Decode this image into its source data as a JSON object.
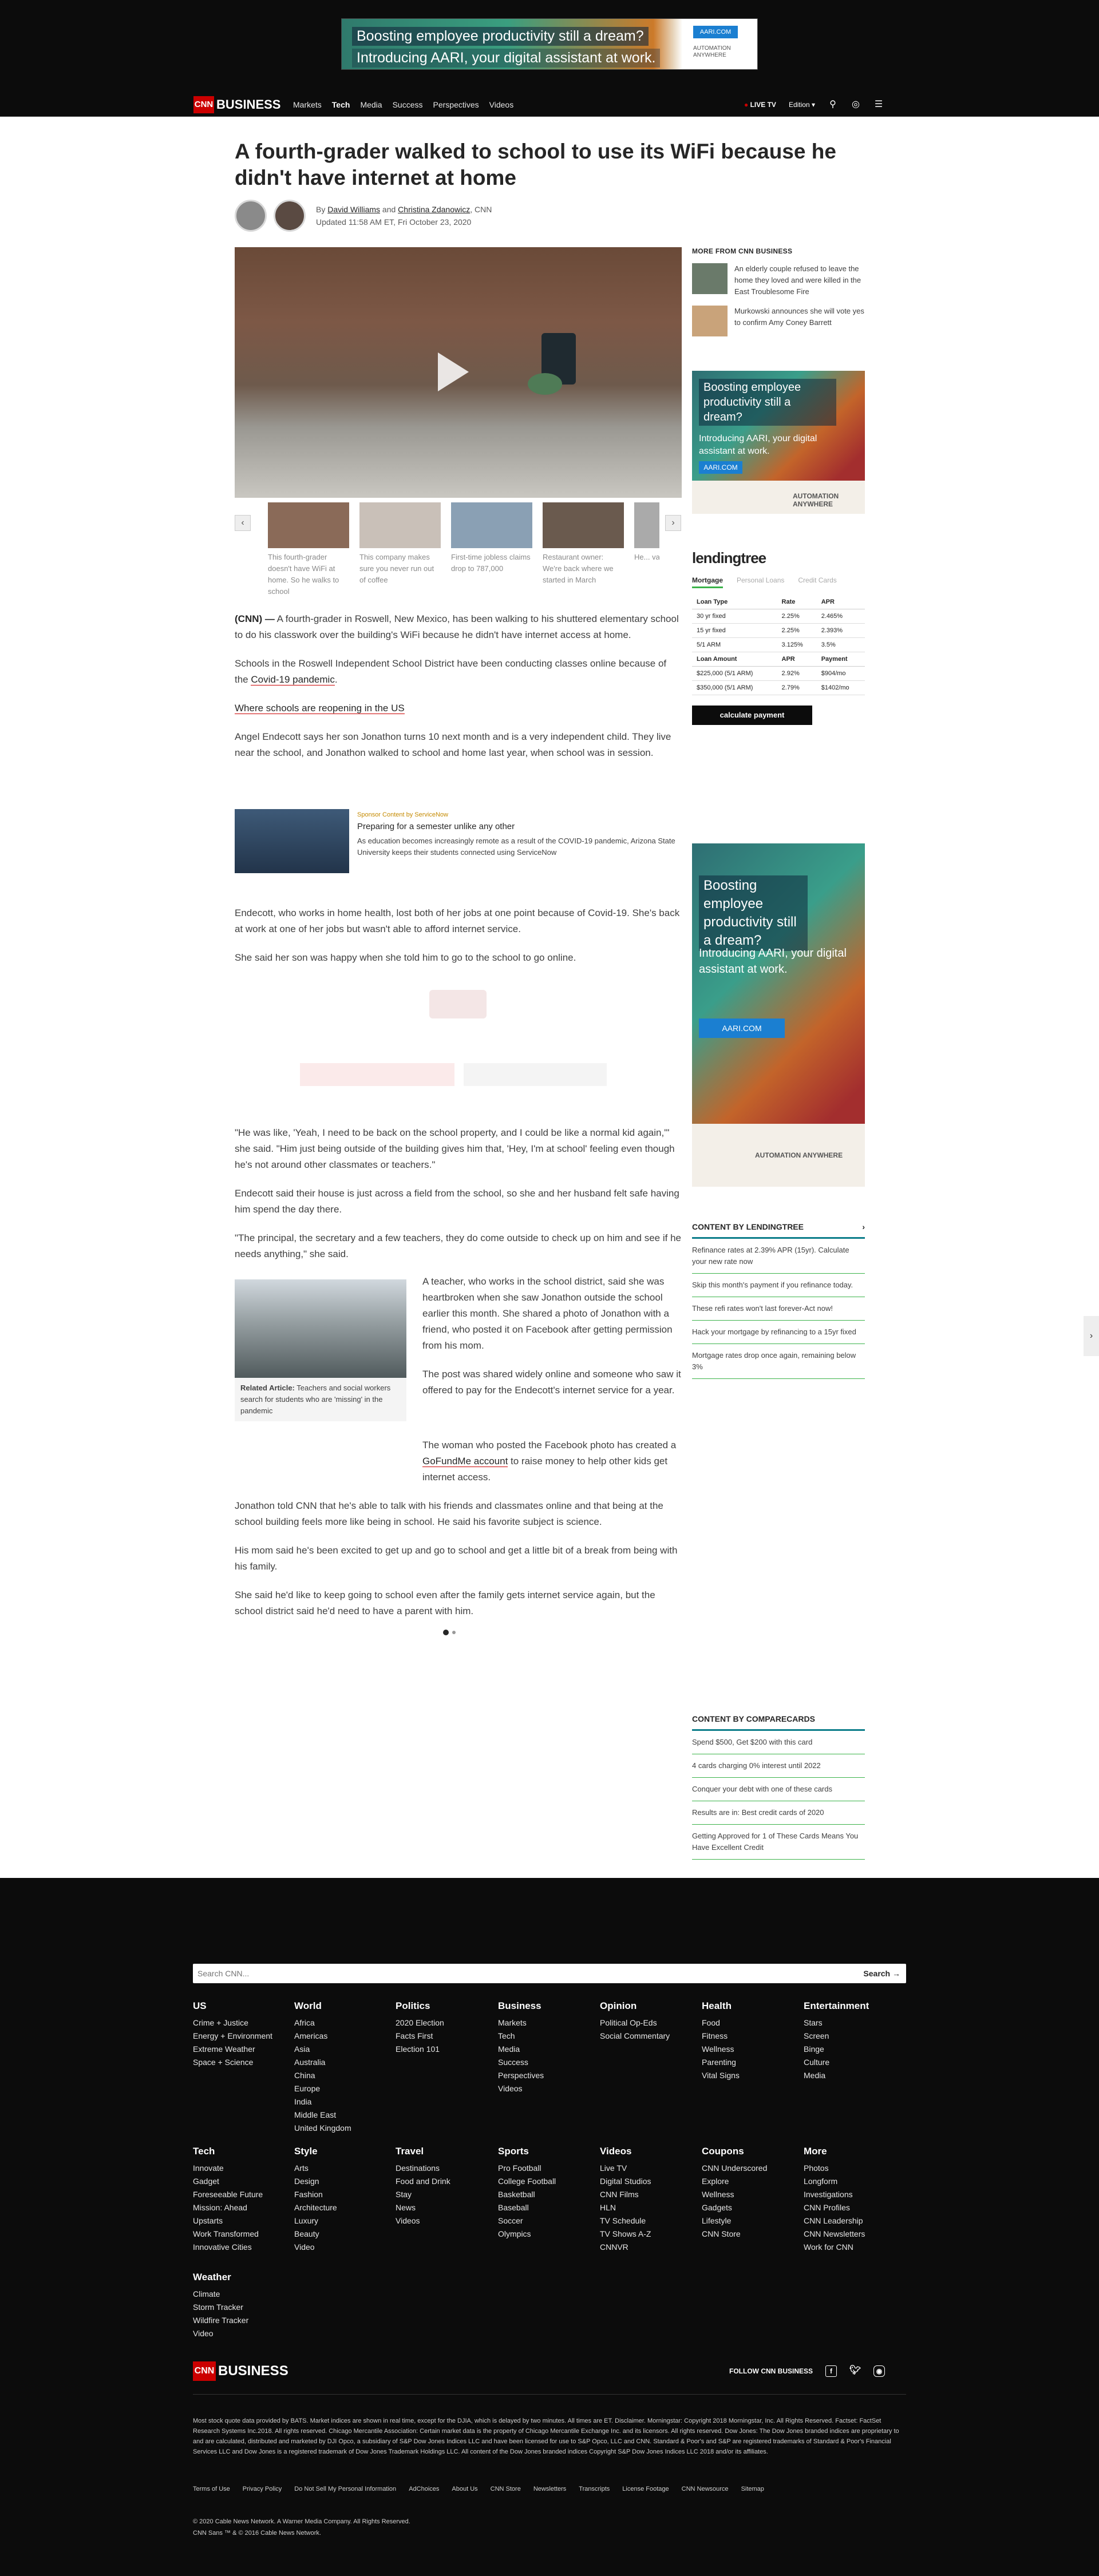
{
  "top_ad": {
    "line1": "Boosting employee productivity still a dream?",
    "line2": "Introducing AARI, your digital assistant at work.",
    "button": "AARI.COM",
    "brand": "AUTOMATION ANYWHERE"
  },
  "nav": {
    "logo_cnn": "CNN",
    "logo_business": "BUSINESS",
    "links": [
      "Markets",
      "Tech",
      "Media",
      "Success",
      "Perspectives",
      "Videos"
    ],
    "active": "Tech",
    "live_tv": "LIVE TV",
    "edition": "Edition"
  },
  "article": {
    "headline": "A fourth-grader walked to school to use its WiFi because he didn't have internet at home",
    "by_prefix": "By",
    "author1": "David Williams",
    "and": "and",
    "author2": "Christina Zdanowicz",
    "outlet": ", CNN",
    "updated": "Updated 11:58 AM ET, Fri October 23, 2020",
    "carousel": [
      {
        "caption": "This fourth-grader doesn't have WiFi at home. So he walks to school",
        "color": "#8a6a58"
      },
      {
        "caption": "This company makes sure you never run out of coffee",
        "color": "#c9c0b8"
      },
      {
        "caption": "First-time jobless claims drop to 787,000",
        "color": "#8aa0b4"
      },
      {
        "caption": "Restaurant owner: We're back where we started in March",
        "color": "#6a5a4e"
      },
      {
        "caption": "He... vac... glo...",
        "color": "#aaa"
      }
    ],
    "p1_lead": "(CNN) —",
    "p1": " A fourth-grader in Roswell, New Mexico, has been walking to his shuttered elementary school to do his classwork over the building's WiFi because he didn't have internet access at home.",
    "p2_a": "Schools in the Roswell Independent School District have been conducting classes online because of the ",
    "p2_link": "Covid-19 pandemic",
    "p2_b": ".",
    "p3_link": "Where schools are reopening in the US",
    "p4": "Angel Endecott says her son Jonathon turns 10 next month and is a very independent child. They live near the school, and Jonathon walked to school and home last year, when school was in session.",
    "sponsor_kicker": "Sponsor Content by ServiceNow",
    "sponsor_title": "Preparing for a semester unlike any other",
    "sponsor_desc": "As education becomes increasingly remote as a result of the COVID-19 pandemic, Arizona State University keeps their students connected using ServiceNow",
    "p5": "Endecott, who works in home health, lost both of her jobs at one point because of Covid-19. She's back at work at one of her jobs but wasn't able to afford internet service.",
    "p6": "She said her son was happy when she told him to go to the school to go online.",
    "p7": "\"He was like, 'Yeah, I need to be back on the school property, and I could be like a normal kid again,'\" she said. \"Him just being outside of the building gives him that, 'Hey, I'm at school' feeling even though he's not around other classmates or teachers.\"",
    "p8": "Endecott said their house is just across a field from the school, so she and her husband felt safe having him spend the day there.",
    "p9": "\"The principal, the secretary and a few teachers, they do come outside to check up on him and see if he needs anything,\" she said.",
    "related_label": "Related Article:",
    "related_text": " Teachers and social workers search for students who are 'missing' in the pandemic",
    "p10": "A teacher, who works in the school district, said she was heartbroken when she saw Jonathon outside the school earlier this month. She shared a photo of Jonathon with a friend, who posted it on Facebook after getting permission from his mom.",
    "p11": "The post was shared widely online and someone who saw it offered to pay for the Endecott's internet service for a year.",
    "p12_a": "The woman who posted the Facebook photo has created a ",
    "p12_link": "GoFundMe account",
    "p12_b": " to raise money to help other kids get internet access.",
    "p13": "Jonathon told CNN that he's able to talk with his friends and classmates online and that being at the school building feels more like being in school. He said his favorite subject is science.",
    "p14": "His mom said he's been excited to get up and go to school and get a little bit of a break from being with his family.",
    "p15": "She said he'd like to keep going to school even after the family gets internet service again, but the school district said he'd need to have a parent with him."
  },
  "rail": {
    "more_header": "MORE FROM CNN BUSINESS",
    "more_items": [
      "An elderly couple refused to leave the home they loved and were killed in the East Troublesome Fire",
      "Murkowski announces she will vote yes to confirm Amy Coney Barrett"
    ],
    "ad1_line1": "Boosting employee productivity still a dream?",
    "ad1_line2": "Introducing AARI, your digital assistant at work.",
    "ad1_button": "AARI.COM",
    "ad1_brand": "AUTOMATION ANYWHERE",
    "lending_brand": "lendingtree",
    "lending_tabs": [
      "Mortgage",
      "Personal Loans",
      "Credit Cards"
    ],
    "rate_headers": [
      "Loan Type",
      "Rate",
      "APR"
    ],
    "rates": [
      [
        "30 yr fixed",
        "2.25%",
        "2.465%"
      ],
      [
        "15 yr fixed",
        "2.25%",
        "2.393%"
      ],
      [
        "5/1 ARM",
        "3.125%",
        "3.5%"
      ]
    ],
    "loan_headers": [
      "Loan Amount",
      "APR",
      "Payment"
    ],
    "loans": [
      [
        "$225,000 (5/1 ARM)",
        "2.92%",
        "$904/mo"
      ],
      [
        "$350,000 (5/1 ARM)",
        "2.79%",
        "$1402/mo"
      ]
    ],
    "calc_button": "calculate payment",
    "ad2_line1": "Boosting employee productivity still a dream?",
    "ad2_line2": "Introducing AARI, your digital assistant at work.",
    "ad2_button": "AARI.COM",
    "ad2_brand": "AUTOMATION ANYWHERE",
    "lt_header": "CONTENT BY LENDINGTREE",
    "lt_items": [
      "Refinance rates at 2.39% APR (15yr). Calculate your new rate now",
      "Skip this month's payment if you refinance today.",
      "These refi rates won't last forever-Act now!",
      "Hack your mortgage by refinancing to a 15yr fixed",
      "Mortgage rates drop once again, remaining below 3%"
    ],
    "cc_header": "CONTENT BY COMPARECARDS",
    "cc_items": [
      "Spend $500, Get $200 with this card",
      "4 cards charging 0% interest until 2022",
      "Conquer your debt with one of these cards",
      "Results are in: Best credit cards of 2020",
      "Getting Approved for 1 of These Cards Means You Have Excellent Credit"
    ]
  },
  "footer": {
    "search_placeholder": "Search CNN...",
    "search_button": "Search →",
    "columns": [
      {
        "h": "US",
        "links": [
          "Crime + Justice",
          "Energy + Environment",
          "Extreme Weather",
          "Space + Science"
        ]
      },
      {
        "h": "World",
        "links": [
          "Africa",
          "Americas",
          "Asia",
          "Australia",
          "China",
          "Europe",
          "India",
          "Middle East",
          "United Kingdom"
        ]
      },
      {
        "h": "Politics",
        "links": [
          "2020 Election",
          "Facts First",
          "Election 101"
        ]
      },
      {
        "h": "Business",
        "links": [
          "Markets",
          "Tech",
          "Media",
          "Success",
          "Perspectives",
          "Videos"
        ]
      },
      {
        "h": "Opinion",
        "links": [
          "Political Op-Eds",
          "Social Commentary"
        ]
      },
      {
        "h": "Health",
        "links": [
          "Food",
          "Fitness",
          "Wellness",
          "Parenting",
          "Vital Signs"
        ]
      },
      {
        "h": "Entertainment",
        "links": [
          "Stars",
          "Screen",
          "Binge",
          "Culture",
          "Media"
        ]
      },
      {
        "h": "Tech",
        "links": [
          "Innovate",
          "Gadget",
          "Foreseeable Future",
          "Mission: Ahead",
          "Upstarts",
          "Work Transformed",
          "Innovative Cities"
        ]
      },
      {
        "h": "Style",
        "links": [
          "Arts",
          "Design",
          "Fashion",
          "Architecture",
          "Luxury",
          "Beauty",
          "Video"
        ]
      },
      {
        "h": "Travel",
        "links": [
          "Destinations",
          "Food and Drink",
          "Stay",
          "News",
          "Videos"
        ]
      },
      {
        "h": "Sports",
        "links": [
          "Pro Football",
          "College Football",
          "Basketball",
          "Baseball",
          "Soccer",
          "Olympics"
        ]
      },
      {
        "h": "Videos",
        "links": [
          "Live TV",
          "Digital Studios",
          "CNN Films",
          "HLN",
          "TV Schedule",
          "TV Shows A-Z",
          "CNNVR"
        ]
      },
      {
        "h": "Coupons",
        "links": [
          "CNN Underscored",
          "Explore",
          "Wellness",
          "Gadgets",
          "Lifestyle",
          "CNN Store"
        ]
      },
      {
        "h": "More",
        "links": [
          "Photos",
          "Longform",
          "Investigations",
          "CNN Profiles",
          "CNN Leadership",
          "CNN Newsletters",
          "Work for CNN"
        ]
      },
      {
        "h": "Weather",
        "links": [
          "Climate",
          "Storm Tracker",
          "Wildfire Tracker",
          "Video"
        ]
      }
    ],
    "follow": "FOLLOW CNN BUSINESS",
    "legal": "Most stock quote data provided by BATS. Market indices are shown in real time, except for the DJIA, which is delayed by two minutes. All times are ET. Disclaimer. Morningstar: Copyright 2018 Morningstar, Inc. All Rights Reserved. Factset: FactSet Research Systems Inc.2018. All rights reserved. Chicago Mercantile Association: Certain market data is the property of Chicago Mercantile Exchange Inc. and its licensors. All rights reserved. Dow Jones: The Dow Jones branded indices are proprietary to and are calculated, distributed and marketed by DJI Opco, a subsidiary of S&P Dow Jones Indices LLC and have been licensed for use to S&P Opco, LLC and CNN. Standard & Poor's and S&P are registered trademarks of Standard & Poor's Financial Services LLC and Dow Jones is a registered trademark of Dow Jones Trademark Holdings LLC. All content of the Dow Jones branded indices Copyright S&P Dow Jones Indices LLC 2018 and/or its affiliates.",
    "links": [
      "Terms of Use",
      "Privacy Policy",
      "Do Not Sell My Personal Information",
      "AdChoices",
      "About Us",
      "CNN Store",
      "Newsletters",
      "Transcripts",
      "License Footage",
      "CNN Newsource",
      "Sitemap"
    ],
    "copy1": "© 2020 Cable News Network.  A Warner Media Company.  All Rights Reserved.",
    "copy2": "CNN Sans ™ & © 2016 Cable News Network."
  }
}
